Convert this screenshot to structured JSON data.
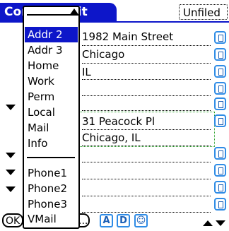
{
  "title": {
    "text": "Contact Edit",
    "category": "Unfiled"
  },
  "fields": [
    {
      "value": "1982 Main Street"
    },
    {
      "value": "Chicago"
    },
    {
      "value": "IL"
    },
    {
      "value": ""
    },
    {
      "value": ""
    },
    {
      "value": "31 Peacock Pl"
    },
    {
      "value": "Chicago, IL"
    },
    {
      "value": ""
    },
    {
      "value": ""
    },
    {
      "value": ""
    },
    {
      "value": ""
    }
  ],
  "menu": {
    "items": [
      "Addr 2",
      "Addr 3",
      "Home",
      "Work",
      "Perm",
      "Local",
      "Mail",
      "Info",
      "Phone1",
      "Phone2",
      "Phone3",
      "VMail"
    ],
    "selected": "Addr 2"
  },
  "buttons": {
    "ok": "OK",
    "details": "...",
    "icons": [
      "A",
      "D",
      "smiley"
    ]
  },
  "colors": {
    "accent": "#0d16c9",
    "icon": "#2f8ce6",
    "highlight_border": "#2aa22a"
  }
}
